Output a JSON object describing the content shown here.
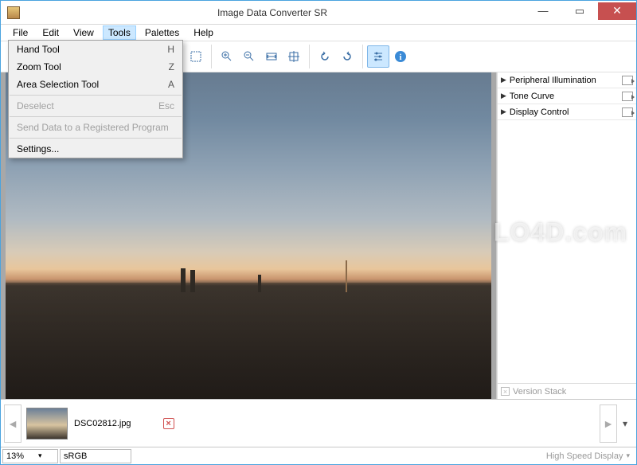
{
  "window": {
    "title": "Image Data Converter SR"
  },
  "menubar": [
    "File",
    "Edit",
    "View",
    "Tools",
    "Palettes",
    "Help"
  ],
  "menubar_active": "Tools",
  "tools_menu": {
    "items": [
      {
        "label": "Hand Tool",
        "shortcut": "H",
        "enabled": true
      },
      {
        "label": "Zoom Tool",
        "shortcut": "Z",
        "enabled": true
      },
      {
        "label": "Area Selection Tool",
        "shortcut": "A",
        "enabled": true
      }
    ],
    "deselect": {
      "label": "Deselect",
      "shortcut": "Esc",
      "enabled": false
    },
    "send": {
      "label": "Send Data to a Registered Program",
      "enabled": false
    },
    "settings": {
      "label": "Settings...",
      "enabled": true
    }
  },
  "panels": [
    {
      "label": "Peripheral Illumination"
    },
    {
      "label": "Tone Curve"
    },
    {
      "label": "Display Control"
    }
  ],
  "thumb": {
    "filename": "DSC02812.jpg"
  },
  "version_stack": {
    "label": "Version Stack"
  },
  "status": {
    "zoom": "13%",
    "colorspace": "sRGB",
    "display_mode": "High Speed Display"
  },
  "watermark": "LO4D.com"
}
